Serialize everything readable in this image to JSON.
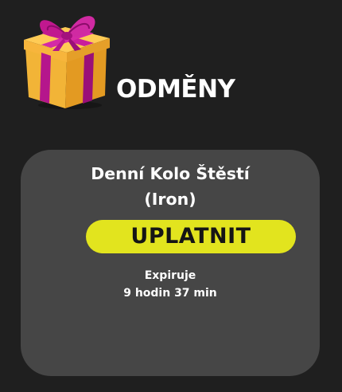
{
  "header": {
    "title": "ODMĚNY",
    "icon": "gift-icon"
  },
  "reward_card": {
    "title_line1": "Denní Kolo Štěstí",
    "title_line2": "(Iron)",
    "redeem_label": "UPLATNIT",
    "expiry_label": "Expiruje",
    "expiry_value": "9 hodin 37 min"
  },
  "colors": {
    "background": "#1f1f1f",
    "card": "#464646",
    "button": "#e2e41e",
    "button_text": "#151515",
    "gift_box": "#f2a92d",
    "ribbon": "#b5168c"
  }
}
